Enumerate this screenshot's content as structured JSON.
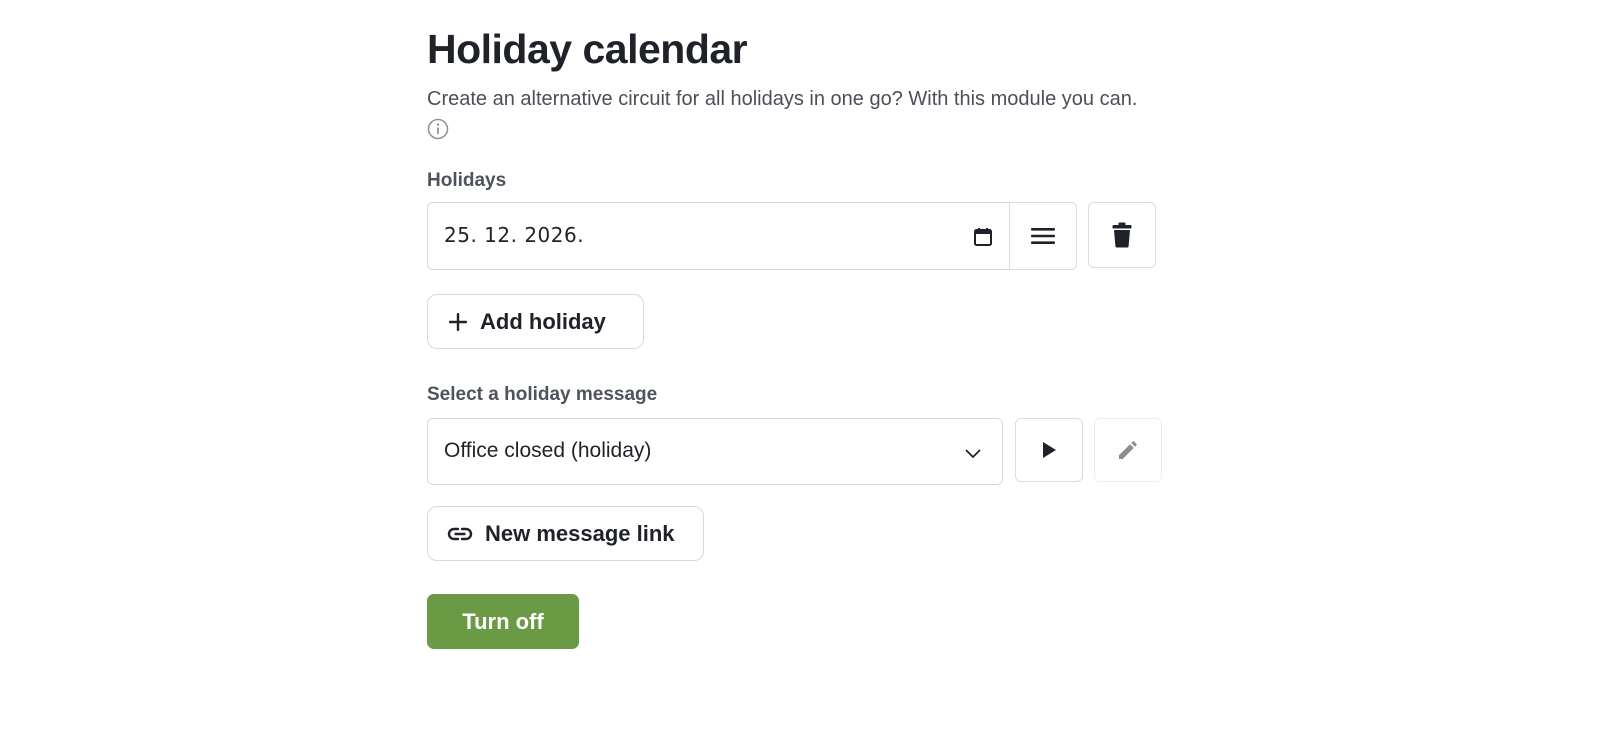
{
  "page": {
    "title": "Holiday calendar",
    "description": "Create an alternative circuit for all holidays in one go? With this module you can."
  },
  "holidays": {
    "label": "Holidays",
    "date_value": "25. 12. 2026.",
    "add_label": "Add holiday"
  },
  "message": {
    "label": "Select a holiday message",
    "selected": "Office closed (holiday)",
    "new_link_label": "New message link"
  },
  "actions": {
    "turn_off_label": "Turn off"
  },
  "colors": {
    "primary": "#6a9a44",
    "border": "#d5d8dc",
    "text": "#1f2329"
  },
  "icons": [
    "info-icon",
    "calendar-icon",
    "reorder-icon",
    "trash-icon",
    "plus-icon",
    "chevron-down-icon",
    "play-icon",
    "pencil-icon",
    "link-icon"
  ]
}
